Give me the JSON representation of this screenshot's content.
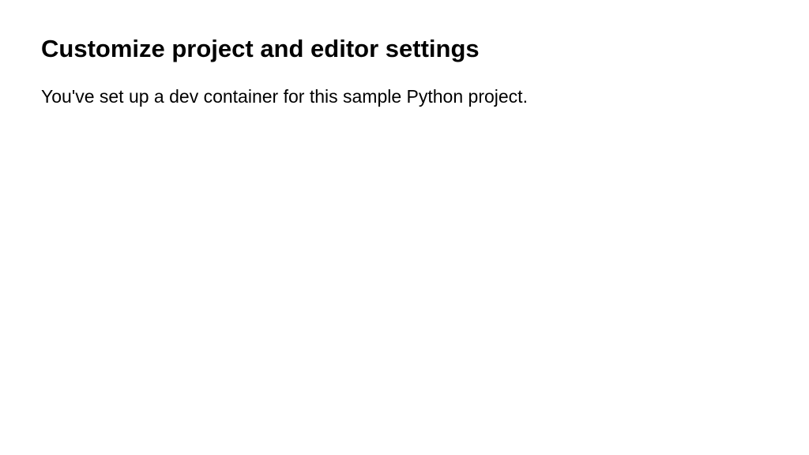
{
  "heading": "Customize project and editor settings",
  "body": "You've set up a dev container for this sample Python project."
}
